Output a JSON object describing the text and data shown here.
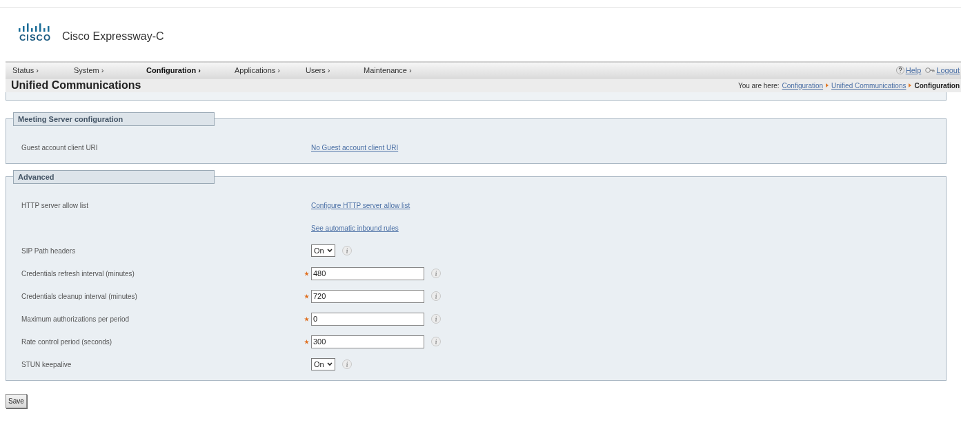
{
  "header": {
    "logo_text": "CISCO",
    "product": "Cisco Expressway-C"
  },
  "nav": [
    {
      "label": "Status ›",
      "selected": false
    },
    {
      "label": "System ›",
      "selected": false
    },
    {
      "label": "Configuration ›",
      "selected": true
    },
    {
      "label": "Applications ›",
      "selected": false
    },
    {
      "label": "Users ›",
      "selected": false
    },
    {
      "label": "Maintenance ›",
      "selected": false
    }
  ],
  "utility_links": [
    {
      "kind": "help",
      "label": "Help"
    },
    {
      "kind": "logout",
      "label": "Logout"
    }
  ],
  "page_title": "Unified Communications",
  "breadcrumb": {
    "prefix": "You are here:",
    "links": [
      "Configuration",
      "Unified Communications"
    ],
    "current": "Configuration"
  },
  "sections": [
    {
      "title": "Meeting Server configuration",
      "rows": [
        {
          "kind": "link",
          "label": "Guest account client URI",
          "value": "No Guest account client URI",
          "required": false,
          "info": false
        }
      ]
    },
    {
      "title": "Advanced",
      "rows": [
        {
          "kind": "link",
          "label": "HTTP server allow list",
          "value": "Configure HTTP server allow list",
          "required": false,
          "info": false
        },
        {
          "kind": "link",
          "value": "See automatic inbound rules",
          "required": false,
          "info": false
        },
        {
          "kind": "select",
          "label": "SIP Path headers",
          "value": "On",
          "required": false,
          "info": true
        },
        {
          "kind": "text",
          "label": "Credentials refresh interval (minutes)",
          "value": "480",
          "required": true,
          "info": true
        },
        {
          "kind": "text",
          "label": "Credentials cleanup interval (minutes)",
          "value": "720",
          "required": true,
          "info": true
        },
        {
          "kind": "text",
          "label": "Maximum authorizations per period",
          "value": "0",
          "required": true,
          "info": true
        },
        {
          "kind": "text",
          "label": "Rate control period (seconds)",
          "value": "300",
          "required": true,
          "info": true
        },
        {
          "kind": "select",
          "label": "STUN keepalive",
          "value": "On",
          "required": false,
          "info": true
        }
      ]
    }
  ],
  "save_button": "Save"
}
